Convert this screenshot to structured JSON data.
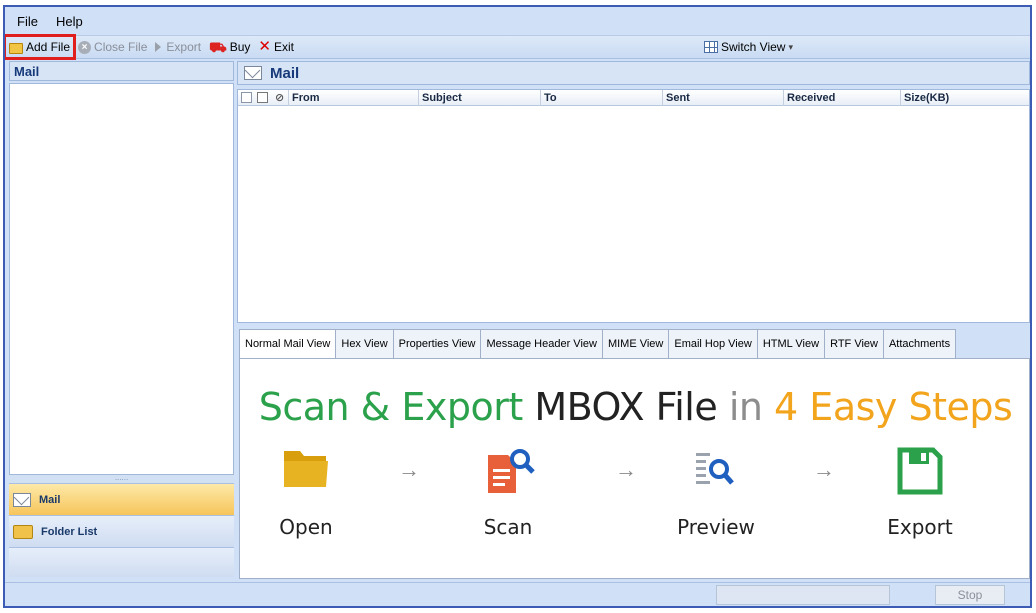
{
  "menu": {
    "file": "File",
    "help": "Help"
  },
  "toolbar": {
    "add_file": "Add File",
    "close_file": "Close File",
    "export": "Export",
    "buy": "Buy",
    "exit": "Exit",
    "switch_view": "Switch View",
    "switch_view_caret": "▾"
  },
  "left_pane": {
    "header": "Mail",
    "splitter_grip": "......",
    "nav": {
      "mail": "Mail",
      "folder_list": "Folder List"
    }
  },
  "main": {
    "title": "Mail",
    "columns": [
      "From",
      "Subject",
      "To",
      "Sent",
      "Received",
      "Size(KB)"
    ]
  },
  "tabs": [
    "Normal Mail View",
    "Hex View",
    "Properties View",
    "Message Header View",
    "MIME View",
    "Email Hop View",
    "HTML View",
    "RTF View",
    "Attachments"
  ],
  "banner": {
    "part1": "Scan & Export ",
    "part2": "MBOX File ",
    "part3": "in ",
    "part4": "4 Easy Steps",
    "arrow": "→",
    "steps": [
      "Open",
      "Scan",
      "Preview",
      "Export"
    ]
  },
  "status": {
    "stop": "Stop"
  },
  "colors": {
    "accent": "#2aa14a",
    "orange": "#f2a41c",
    "highlight": "#e01e1e",
    "folder": "#d99e0b"
  }
}
